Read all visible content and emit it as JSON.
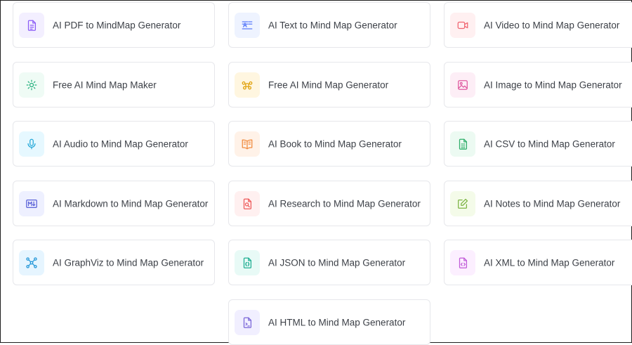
{
  "cards": [
    {
      "label": "AI PDF to MindMap Generator",
      "icon": "pdf-file-icon",
      "bg": "#f3efff",
      "color": "#8b5cf6"
    },
    {
      "label": "AI Text to Mind Map Generator",
      "icon": "text-lines-icon",
      "bg": "#eef3ff",
      "color": "#5b7cfa"
    },
    {
      "label": "AI Video to Mind Map Generator",
      "icon": "video-camera-icon",
      "bg": "#fff0f1",
      "color": "#f06470"
    },
    {
      "label": "Free AI Mind Map Maker",
      "icon": "sparkle-icon",
      "bg": "#effbf5",
      "color": "#22b07d"
    },
    {
      "label": "Free AI Mind Map Generator",
      "icon": "mind-map-icon",
      "bg": "#fff6e0",
      "color": "#e0a10a"
    },
    {
      "label": "AI Image to Mind Map Generator",
      "icon": "image-icon",
      "bg": "#fdeef6",
      "color": "#e05aa0"
    },
    {
      "label": "AI Audio to Mind Map Generator",
      "icon": "microphone-icon",
      "bg": "#e6f8ff",
      "color": "#22a7d8"
    },
    {
      "label": "AI Book to Mind Map Generator",
      "icon": "open-book-icon",
      "bg": "#fff2e8",
      "color": "#f08a3c"
    },
    {
      "label": "AI CSV to Mind Map Generator",
      "icon": "csv-file-icon",
      "bg": "#ecfaf2",
      "color": "#2fae6a"
    },
    {
      "label": "AI Markdown to Mind Map Generator",
      "icon": "markdown-icon",
      "bg": "#eef0ff",
      "color": "#5a62d8"
    },
    {
      "label": "AI Research to Mind Map Generator",
      "icon": "research-document-icon",
      "bg": "#fff0f0",
      "color": "#ee5a5a"
    },
    {
      "label": "AI Notes to Mind Map Generator",
      "icon": "note-edit-icon",
      "bg": "#f4fbe9",
      "color": "#7cb342"
    },
    {
      "label": "AI GraphViz to Mind Map Generator",
      "icon": "graph-nodes-icon",
      "bg": "#e6f5ff",
      "color": "#2196d8"
    },
    {
      "label": "AI JSON to Mind Map Generator",
      "icon": "json-file-icon",
      "bg": "#e8faf6",
      "color": "#1eae92"
    },
    {
      "label": "AI XML to Mind Map Generator",
      "icon": "xml-file-icon",
      "bg": "#fcefff",
      "color": "#c05ad8"
    },
    {
      "label": "AI HTML to Mind Map Generator",
      "icon": "html-file-icon",
      "bg": "#f1efff",
      "color": "#7a66d8"
    }
  ]
}
